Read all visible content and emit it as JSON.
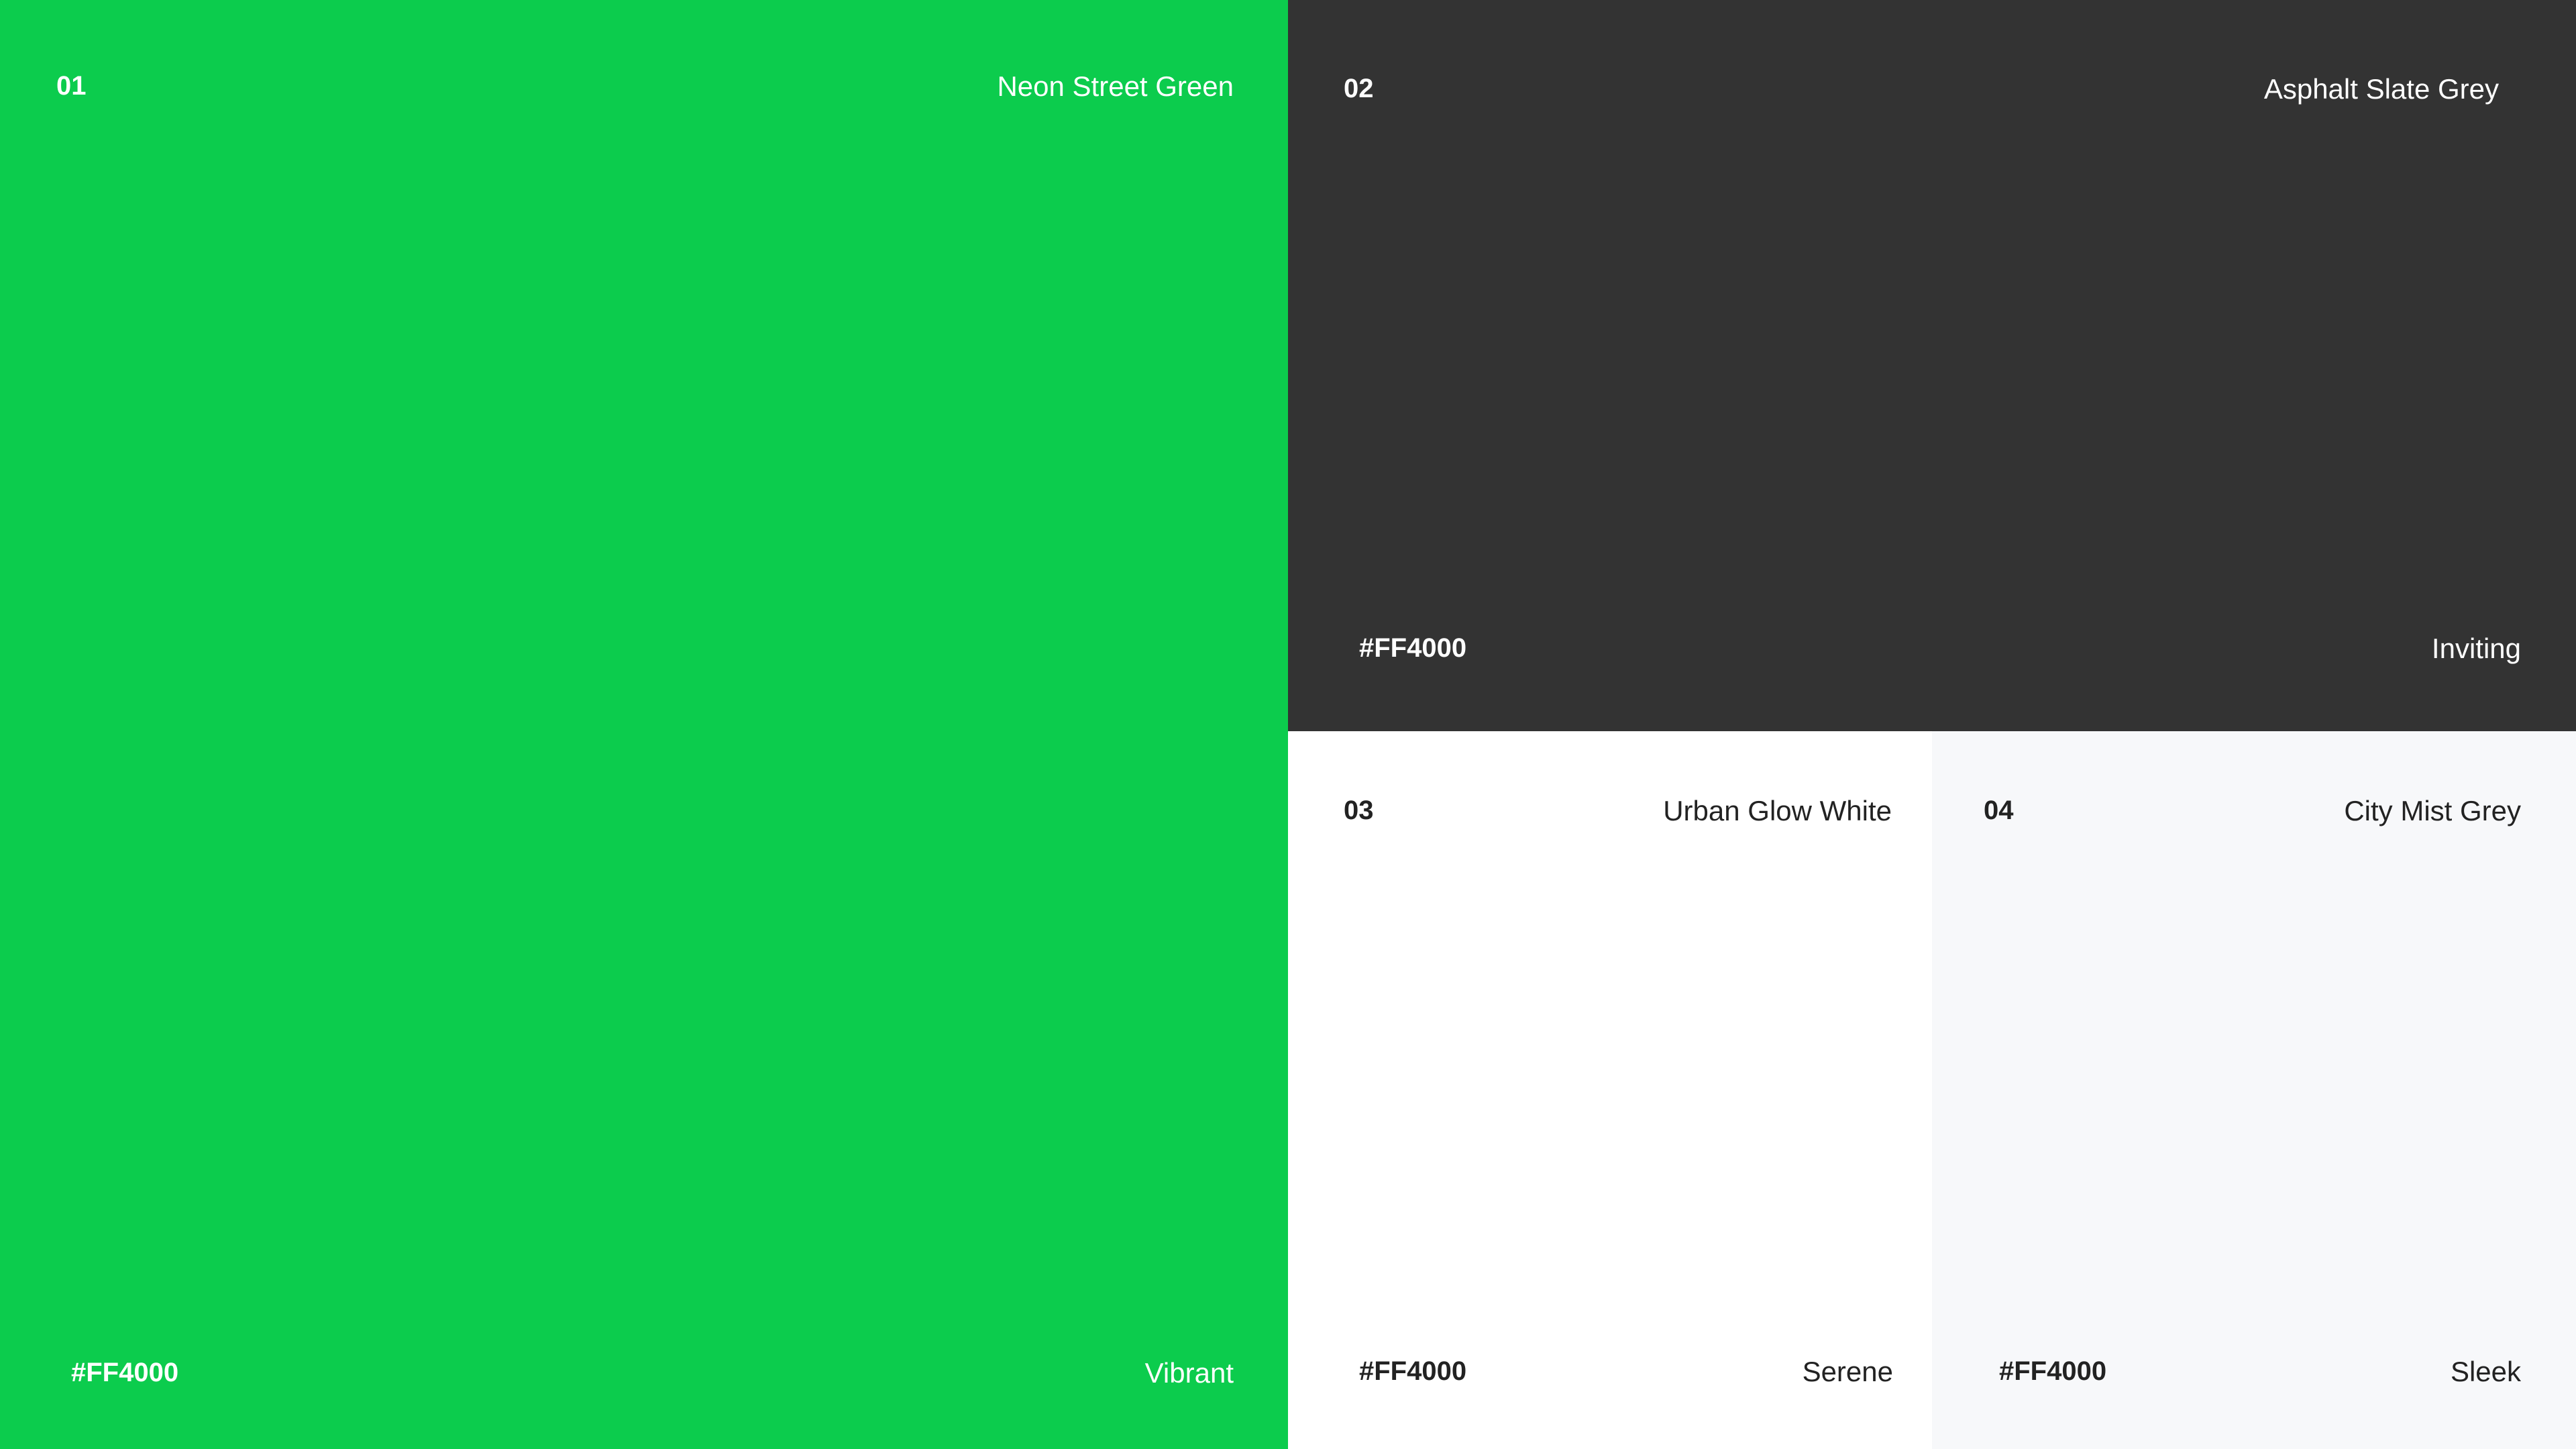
{
  "swatches": [
    {
      "number": "01",
      "name": "Neon Street Green",
      "hex_label": "#FF4000",
      "descriptor": "Vibrant",
      "background": "#0CCC4D",
      "text_color": "#FFFFFF"
    },
    {
      "number": "02",
      "name": "Asphalt Slate Grey",
      "hex_label": "#FF4000",
      "descriptor": "Inviting",
      "background": "#333333",
      "text_color": "#FFFFFF"
    },
    {
      "number": "03",
      "name": "Urban Glow White",
      "hex_label": "#FF4000",
      "descriptor": "Serene",
      "background": "#FFFFFF",
      "text_color": "#222222"
    },
    {
      "number": "04",
      "name": "City Mist Grey",
      "hex_label": "#FF4000",
      "descriptor": "Sleek",
      "background": "#F7F8FA",
      "text_color": "#222222"
    }
  ]
}
